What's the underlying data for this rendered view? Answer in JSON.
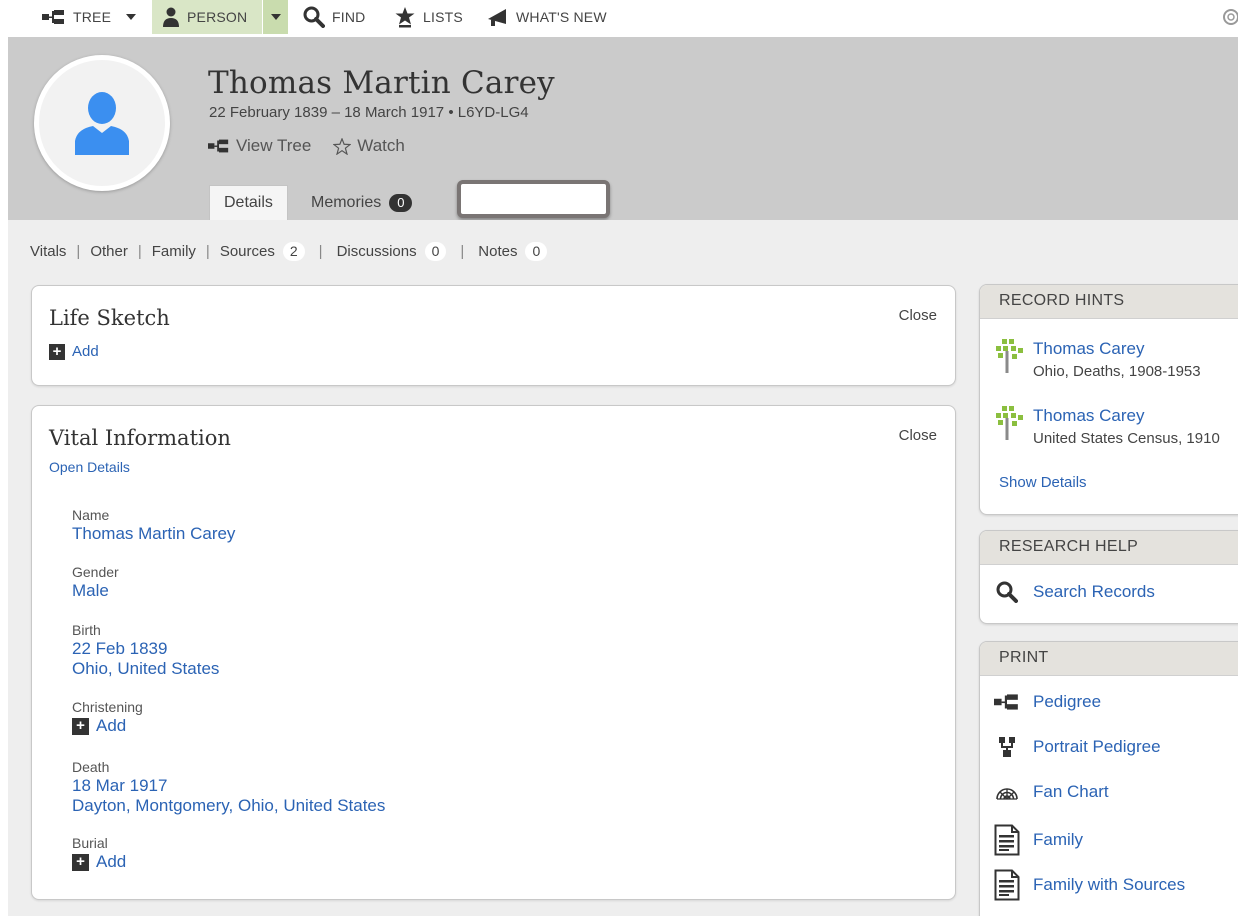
{
  "nav": {
    "tree": "TREE",
    "person": "PERSON",
    "find": "FIND",
    "lists": "LISTS",
    "whats_new": "WHAT'S NEW"
  },
  "person": {
    "name": "Thomas Martin Carey",
    "meta": "22 February 1839 – 18 March 1917 • L6YD-LG4",
    "view_tree": "View Tree",
    "watch": "Watch"
  },
  "tabs": {
    "details": "Details",
    "memories": "Memories",
    "memories_count": "0"
  },
  "subnav": {
    "vitals": "Vitals",
    "other": "Other",
    "family": "Family",
    "sources": "Sources",
    "sources_count": "2",
    "discussions": "Discussions",
    "discussions_count": "0",
    "notes": "Notes",
    "notes_count": "0"
  },
  "life_sketch": {
    "title": "Life Sketch",
    "close": "Close",
    "add": "Add"
  },
  "vital_info": {
    "title": "Vital Information",
    "close": "Close",
    "open_details": "Open Details",
    "name_label": "Name",
    "name_value": "Thomas Martin Carey",
    "gender_label": "Gender",
    "gender_value": "Male",
    "birth_label": "Birth",
    "birth_date": "22 Feb 1839",
    "birth_place": "Ohio, United States",
    "christening_label": "Christening",
    "christening_add": "Add",
    "death_label": "Death",
    "death_date": "18 Mar 1917",
    "death_place": "Dayton, Montgomery, Ohio, United States",
    "burial_label": "Burial",
    "burial_add": "Add"
  },
  "record_hints": {
    "title": "RECORD HINTS",
    "hints": [
      {
        "name": "Thomas Carey",
        "source": "Ohio, Deaths, 1908-1953"
      },
      {
        "name": "Thomas Carey",
        "source": "United States Census, 1910"
      }
    ],
    "show_details": "Show Details"
  },
  "research_help": {
    "title": "RESEARCH HELP",
    "search_records": "Search Records"
  },
  "print": {
    "title": "PRINT",
    "items": [
      "Pedigree",
      "Portrait Pedigree",
      "Fan Chart",
      "Family",
      "Family with Sources"
    ]
  },
  "colors": {
    "link": "#2b63b4",
    "header_band": "#cbcbcb",
    "person_nav_bg": "#d9e6c6",
    "avatar_blue": "#3b8ff0",
    "hint_tree_green": "#8bbf3f"
  },
  "icons": [
    "tree-icon",
    "person-icon",
    "search-icon",
    "lists-icon",
    "megaphone-icon",
    "help-icon",
    "avatar-icon",
    "star-icon",
    "plus-icon",
    "hint-tree-icon",
    "pedigree-icon",
    "portrait-pedigree-icon",
    "fan-chart-icon",
    "document-icon"
  ]
}
